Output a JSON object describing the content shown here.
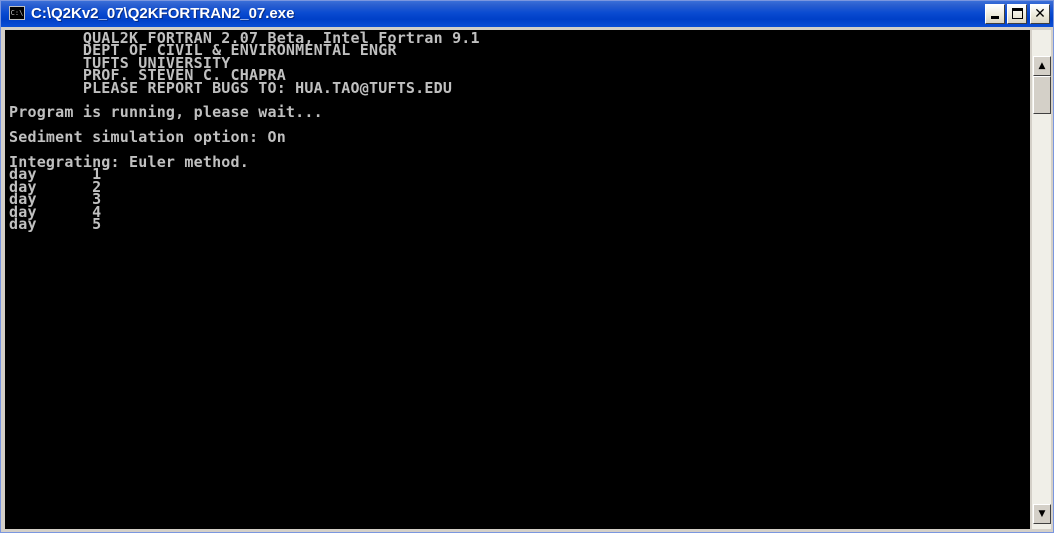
{
  "window": {
    "title": "C:\\Q2Kv2_07\\Q2KFORTRAN2_07.exe",
    "icon": "console-app-icon",
    "icon_text": "C:\\"
  },
  "controls": {
    "minimize_icon": "minimize-icon",
    "maximize_icon": "maximize-icon",
    "close_icon": "close-icon",
    "close_glyph": "✕"
  },
  "console": {
    "background": "#000000",
    "foreground": "#c0c0c0",
    "output": "        QUAL2K FORTRAN 2.07 Beta, Intel Fortran 9.1\n        DEPT OF CIVIL & ENVIRONMENTAL ENGR\n        TUFTS UNIVERSITY\n        PROF. STEVEN C. CHAPRA\n        PLEASE REPORT BUGS TO: HUA.TAO@TUFTS.EDU\n\nProgram is running, please wait...\n\nSediment simulation option: On\n\nIntegrating: Euler method.\nday      1\nday      2\nday      3\nday      4\nday      5"
  },
  "scrollbar": {
    "up_glyph": "▲",
    "down_glyph": "▼"
  },
  "colors": {
    "titlebar": "#0a4bd1",
    "frame": "#d4d0c8"
  }
}
